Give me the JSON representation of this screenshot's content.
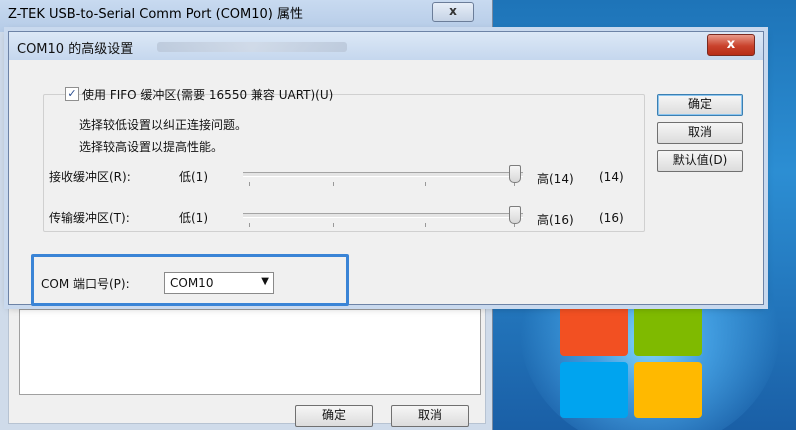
{
  "parent_window": {
    "title": "Z-TEK USB-to-Serial Comm Port (COM10) 属性",
    "close_glyph": "x",
    "ok_label": "确定",
    "cancel_label": "取消"
  },
  "dialog": {
    "title": "COM10 的高级设置",
    "close_glyph": "x",
    "fifo_checkbox": {
      "checked": true,
      "label": "使用 FIFO 缓冲区(需要 16550 兼容 UART)(U)"
    },
    "hints": [
      "选择较低设置以纠正连接问题。",
      "选择较高设置以提高性能。"
    ],
    "receive_buffer": {
      "label": "接收缓冲区(R):",
      "low_label": "低(1)",
      "high_label": "高(14)",
      "current_value": "(14)"
    },
    "transmit_buffer": {
      "label": "传输缓冲区(T):",
      "low_label": "低(1)",
      "high_label": "高(16)",
      "current_value": "(16)"
    },
    "com_port": {
      "label": "COM 端口号(P):",
      "selected": "COM10"
    },
    "buttons": {
      "ok": "确定",
      "cancel": "取消",
      "defaults": "默认值(D)"
    }
  },
  "colors": {
    "highlight_border": "#3a84d6",
    "close_button": "#c9422c"
  }
}
